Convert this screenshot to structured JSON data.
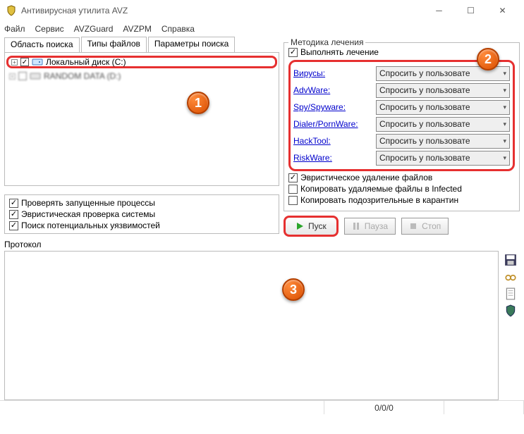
{
  "window": {
    "title": "Антивирусная утилита AVZ"
  },
  "menu": {
    "file": "Файл",
    "service": "Сервис",
    "avzguard": "AVZGuard",
    "avzpm": "AVZPM",
    "help": "Справка"
  },
  "tabs": {
    "area": "Область поиска",
    "types": "Типы файлов",
    "params": "Параметры поиска"
  },
  "drives": {
    "item1": "Локальный диск (C:)",
    "item2": "RANDOM DATA (D:)"
  },
  "checks_left": {
    "c1": "Проверять запущенные процессы",
    "c2": "Эвристическая проверка системы",
    "c3": "Поиск потенциальных уязвимостей"
  },
  "treatment": {
    "group": "Методика лечения",
    "enable": "Выполнять лечение",
    "labels": {
      "virus": "Вирусы:",
      "advware": "AdvWare:",
      "spy": "Spy/Spyware:",
      "dialer": "Dialer/PornWare:",
      "hacktool": "HackTool:",
      "riskware": "RiskWare:"
    },
    "option": "Спросить у пользовате",
    "extra": {
      "e1": "Эвристическое удаление файлов",
      "e2": "Копировать удаляемые файлы в Infected",
      "e3": "Копировать подозрительные в карантин"
    }
  },
  "buttons": {
    "start": "Пуск",
    "pause": "Пауза",
    "stop": "Стоп"
  },
  "protocol": {
    "label": "Протокол"
  },
  "status": {
    "counts": "0/0/0"
  },
  "badges": {
    "b1": "1",
    "b2": "2",
    "b3": "3"
  }
}
